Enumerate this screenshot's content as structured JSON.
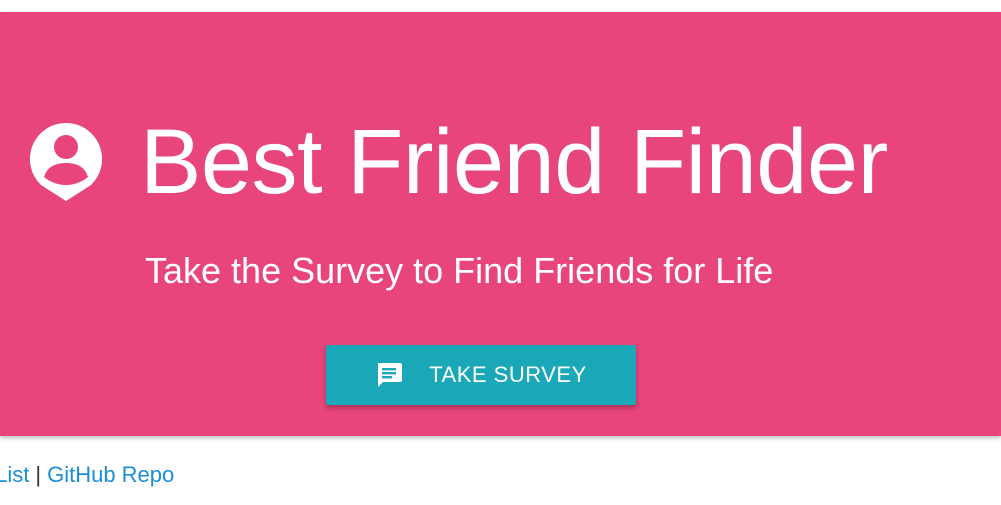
{
  "hero": {
    "title": "Best Friend Finder",
    "subtitle": "Take the Survey to Find Friends for Life",
    "icon": "person-pin-icon",
    "background_color": "#e8457a"
  },
  "survey_button": {
    "label": "TAKE SURVEY",
    "icon": "chat-icon",
    "color": "#1aa7b8"
  },
  "footer": {
    "links": [
      {
        "label": "s List"
      },
      {
        "label": "GitHub Repo"
      }
    ],
    "separator": "|",
    "link_color": "#1a8fd6"
  }
}
